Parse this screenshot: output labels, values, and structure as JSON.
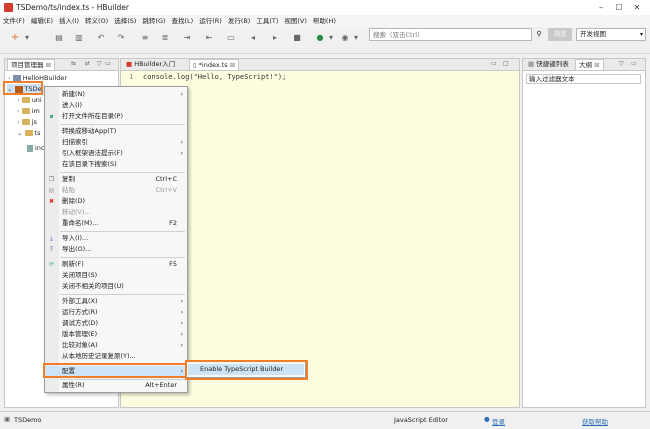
{
  "window": {
    "title": "TSDemo/ts/index.ts - HBuilder"
  },
  "menubar": [
    "文件(F)",
    "编辑(E)",
    "插入(I)",
    "转义(O)",
    "选择(S)",
    "跳转(G)",
    "查找(L)",
    "运行(R)",
    "发行(B)",
    "工具(T)",
    "视图(V)",
    "帮助(H)"
  ],
  "toolbar": {
    "search_placeholder": "搜索（双击Ctrl）",
    "preview_label": "浏览",
    "view_select": "开发视图"
  },
  "explorer": {
    "tab_label": "项目管理器",
    "items": [
      "HelloHBuilder",
      "TSDe",
      "uni",
      "im",
      "js",
      "ts",
      "inc"
    ]
  },
  "editor": {
    "tabs": [
      "HBuilder入门",
      "*index.ts"
    ],
    "line_number": "1",
    "code": "console.log(\"Hello, TypeScript!\");"
  },
  "right_panel": {
    "tabs": [
      "快捷键列表",
      "大纲"
    ],
    "filter_placeholder": "输入过滤器文本"
  },
  "context_menu": {
    "items": [
      {
        "label": "新建(N)",
        "arrow": "›"
      },
      {
        "label": "进入(I)"
      },
      {
        "label": "打开文件所在目录(P)"
      },
      {
        "label": "转换成移动App(T)"
      },
      {
        "label": "扫描索引",
        "arrow": "›"
      },
      {
        "label": "引入框架语法提示(F)",
        "arrow": "›"
      },
      {
        "label": "在该目录下搜索(S)"
      },
      {
        "label": "复制",
        "shortcut": "Ctrl+C"
      },
      {
        "label": "粘贴",
        "shortcut": "Ctrl+V"
      },
      {
        "label": "删除(D)"
      },
      {
        "label": "移动(V)..."
      },
      {
        "label": "重命名(M)...",
        "shortcut": "F2"
      },
      {
        "label": "导入(I)..."
      },
      {
        "label": "导出(O)..."
      },
      {
        "label": "刷新(F)",
        "shortcut": "F5"
      },
      {
        "label": "关闭项目(S)"
      },
      {
        "label": "关闭不相关的项目(U)"
      },
      {
        "label": "外部工具(X)",
        "arrow": "›"
      },
      {
        "label": "运行方式(R)",
        "arrow": "›"
      },
      {
        "label": "调试方式(D)",
        "arrow": "›"
      },
      {
        "label": "版本管理(E)",
        "arrow": "›"
      },
      {
        "label": "比较对象(A)",
        "arrow": "›"
      },
      {
        "label": "从本地历史记录复原(Y)..."
      },
      {
        "label": "配置",
        "arrow": "›"
      },
      {
        "label": "属性(R)",
        "shortcut": "Alt+Enter"
      }
    ],
    "submenu_item": "Enable TypeScript Builder"
  },
  "status": {
    "project": "TSDemo",
    "editor_type": "JavaScript Editor",
    "login": "登录",
    "link": "获取帮助"
  },
  "colors": {
    "highlight_orange": "#f07f2b",
    "menu_selected": "#cde4f7",
    "editor_line": "#fdfde0"
  }
}
